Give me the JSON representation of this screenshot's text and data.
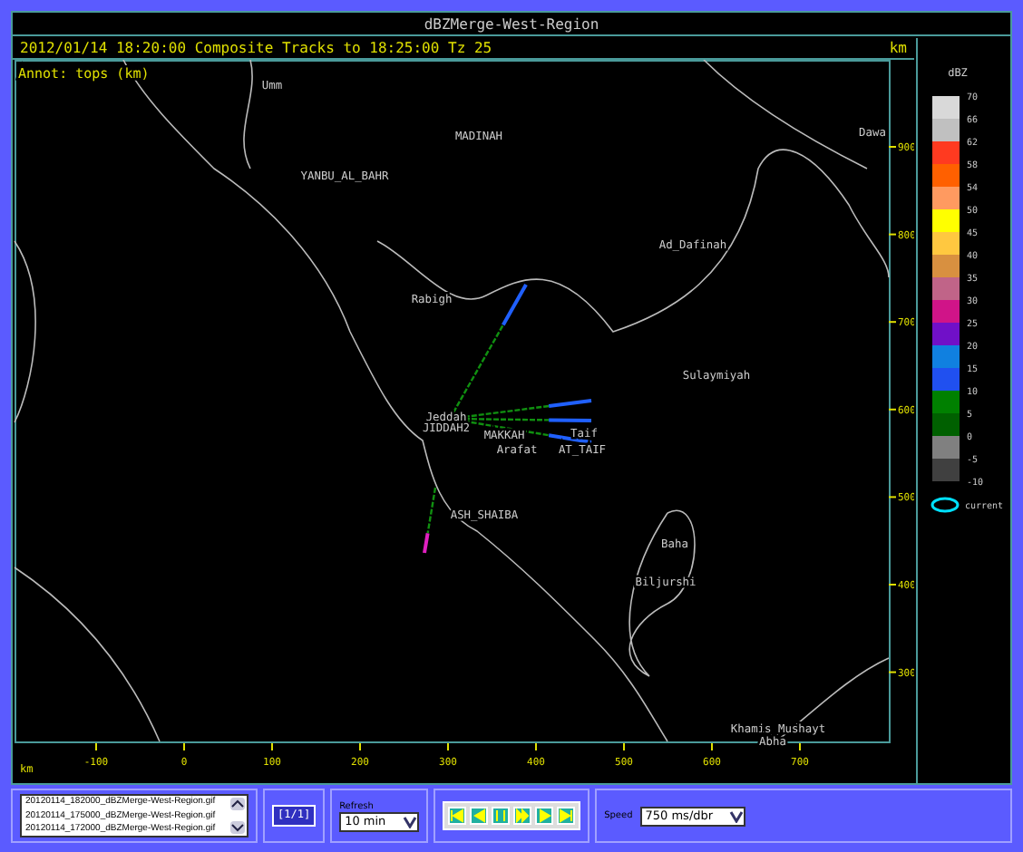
{
  "title": "dBZMerge-West-Region",
  "header": {
    "text": "2012/01/14 18:20:00  Composite Tracks to 18:25:00 Tz 25",
    "unit": "km"
  },
  "annotation": "Annot: tops (km)",
  "places": [
    {
      "label": "Umm"
    },
    {
      "label": "MADINAH"
    },
    {
      "label": "YANBU_AL_BAHR"
    },
    {
      "label": "Ad_Dafinah"
    },
    {
      "label": "Rabigh"
    },
    {
      "label": "Sulaymiyah"
    },
    {
      "label": "Jeddah"
    },
    {
      "label": "JIDDAH2"
    },
    {
      "label": "MAKKAH"
    },
    {
      "label": "Arafat"
    },
    {
      "label": "Taif"
    },
    {
      "label": "AT_TAIF"
    },
    {
      "label": "ASH_SHAIBA"
    },
    {
      "label": "Baha"
    },
    {
      "label": "Biljurshi"
    },
    {
      "label": "Khamis_Mushayt"
    },
    {
      "label": "Abha"
    },
    {
      "label": "Dawa"
    }
  ],
  "y_axis": {
    "ticks": [
      "900",
      "800",
      "700",
      "600",
      "500",
      "400",
      "300"
    ]
  },
  "x_axis": {
    "unit": "km",
    "ticks": [
      "-100",
      "0",
      "100",
      "200",
      "300",
      "400",
      "500",
      "600",
      "700"
    ]
  },
  "legend": {
    "title": "dBZ",
    "bins": [
      {
        "label": "70",
        "color": "#d9d9d9"
      },
      {
        "label": "66",
        "color": "#c0c0c0"
      },
      {
        "label": "62",
        "color": "#ff3a20"
      },
      {
        "label": "58",
        "color": "#ff6000"
      },
      {
        "label": "54",
        "color": "#ff9a60"
      },
      {
        "label": "50",
        "color": "#ffff00"
      },
      {
        "label": "45",
        "color": "#ffc840"
      },
      {
        "label": "40",
        "color": "#d89040"
      },
      {
        "label": "35",
        "color": "#c06488"
      },
      {
        "label": "30",
        "color": "#d01488"
      },
      {
        "label": "25",
        "color": "#7010c8"
      },
      {
        "label": "20",
        "color": "#1080e0"
      },
      {
        "label": "15",
        "color": "#2050f0"
      },
      {
        "label": "10",
        "color": "#008000"
      },
      {
        "label": "5",
        "color": "#006000"
      },
      {
        "label": "0",
        "color": "#808080"
      },
      {
        "label": "-5",
        "color": "#404040"
      }
    ],
    "last_label": "-10",
    "current_label": "current"
  },
  "controls": {
    "files": [
      "20120114_182000_dBZMerge-West-Region.gif",
      "20120114_175000_dBZMerge-West-Region.gif",
      "20120114_172000_dBZMerge-West-Region.gif"
    ],
    "page": "[1/1]",
    "refresh": {
      "label": "Refresh",
      "value": "10 min"
    },
    "player": [
      {
        "kind": "first"
      },
      {
        "kind": "back"
      },
      {
        "kind": "pause"
      },
      {
        "kind": "forward"
      },
      {
        "kind": "play"
      },
      {
        "kind": "last"
      }
    ],
    "speed": {
      "label": "Speed",
      "value": "750 ms/dbr"
    }
  }
}
